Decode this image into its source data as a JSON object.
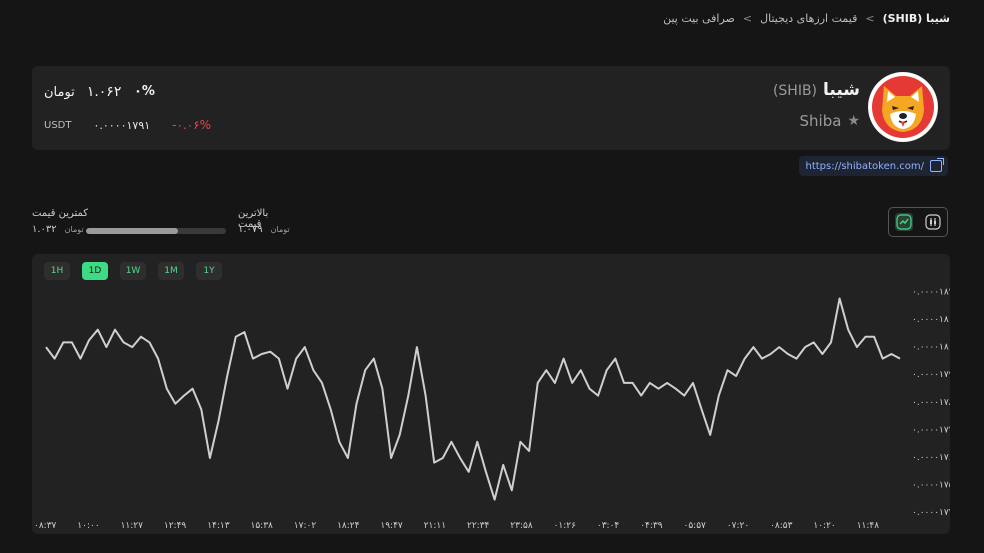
{
  "breadcrumb": {
    "items": [
      "صرافی بیت پین",
      "قیمت ارزهای دیجیتال",
      "شیبا (SHIB)"
    ],
    "separator": ">"
  },
  "coin": {
    "name_fa": "شیبا",
    "symbol": "(SHIB)",
    "name_en": "Shiba",
    "logo": "shiba-inu-logo-icon",
    "favorite_icon": "star-icon"
  },
  "price": {
    "toman_value": "۱.۰۶۲",
    "toman_unit": "تومان",
    "change": "۰%",
    "usdt_label": "USDT",
    "usdt_value": "۰.۰۰۰۰۱۷۹۱",
    "usdt_change": "-۰.۰۶%"
  },
  "website": {
    "url": "https://shibatoken.com/",
    "icon": "external-link-icon"
  },
  "range": {
    "low_label": "کمترین قیمت",
    "high_label": "بالاترین قیمت",
    "low_value": "۱.۰۳۲",
    "high_value": "۱.۰۷۹",
    "unit": "تومان",
    "position": 0.66
  },
  "view_toggle": {
    "line_icon": "line-chart-icon",
    "candle_icon": "candlestick-icon"
  },
  "timeframes": [
    {
      "label": "1H",
      "active": false
    },
    {
      "label": "1D",
      "active": true
    },
    {
      "label": "1W",
      "active": false
    },
    {
      "label": "1M",
      "active": false
    },
    {
      "label": "1Y",
      "active": false
    }
  ],
  "colors": {
    "accent": "#3ddc84",
    "negative": "#e5484d",
    "line": "#cfcfcf",
    "link": "#8fb2ff"
  },
  "chart_data": {
    "type": "line",
    "title": "",
    "xlabel": "",
    "ylabel": "",
    "ylim": [
      1.74e-05,
      1.822e-05
    ],
    "yticks": [
      "۰.۰۰۰۰۱۸۲",
      "۰.۰۰۰۰۱۸۱",
      "۰.۰۰۰۰۱۸",
      "۰.۰۰۰۰۱۷۹",
      "۰.۰۰۰۰۱۷۸",
      "۰.۰۰۰۰۱۷۷",
      "۰.۰۰۰۰۱۷۶",
      "۰.۰۰۰۰۱۷۵",
      "۰.۰۰۰۰۱۷۴"
    ],
    "ytick_values": [
      1.82e-05,
      1.81e-05,
      1.8e-05,
      1.79e-05,
      1.78e-05,
      1.77e-05,
      1.76e-05,
      1.75e-05,
      1.74e-05
    ],
    "xticks": [
      "۰۸:۳۷",
      "۱۰:۰۰",
      "۱۱:۲۷",
      "۱۲:۴۹",
      "۱۴:۱۳",
      "۱۵:۳۸",
      "۱۷:۰۲",
      "۱۸:۲۴",
      "۱۹:۴۷",
      "۲۱:۱۱",
      "۲۲:۳۴",
      "۲۳:۵۸",
      "۰۱:۲۶",
      "۰۳:۰۴",
      "۰۴:۳۹",
      "۰۵:۵۷",
      "۰۷:۲۰",
      "۰۸:۵۳",
      "۱۰:۲۰",
      "۱۱:۴۸"
    ],
    "series": [
      {
        "values": [
          1.79984e-05,
          1.79565e-05,
          1.80152e-05,
          1.80152e-05,
          1.79565e-05,
          1.80236e-05,
          1.80613e-05,
          1.79984e-05,
          1.80613e-05,
          1.80152e-05,
          1.79984e-05,
          1.80362e-05,
          1.80152e-05,
          1.79565e-05,
          1.78475e-05,
          1.7793e-05,
          1.78223e-05,
          1.78475e-05,
          1.77721e-05,
          1.7596e-05,
          1.77301e-05,
          1.78935e-05,
          1.80362e-05,
          1.80529e-05,
          1.79565e-05,
          1.79733e-05,
          1.79817e-05,
          1.79565e-05,
          1.78475e-05,
          1.79565e-05,
          1.79984e-05,
          1.79146e-05,
          1.78684e-05,
          1.77721e-05,
          1.76547e-05,
          1.7596e-05,
          1.7793e-05,
          1.79146e-05,
          1.79565e-05,
          1.78475e-05,
          1.7596e-05,
          1.76798e-05,
          1.78223e-05,
          1.79984e-05,
          1.78223e-05,
          1.75793e-05,
          1.7596e-05,
          1.76547e-05,
          1.7596e-05,
          1.75457e-05,
          1.76547e-05,
          1.75457e-05,
          1.74451e-05,
          1.75709e-05,
          1.74786e-05,
          1.76547e-05,
          1.76212e-05,
          1.78684e-05,
          1.79146e-05,
          1.78684e-05,
          1.79565e-05,
          1.78684e-05,
          1.79146e-05,
          1.78475e-05,
          1.78223e-05,
          1.79146e-05,
          1.79565e-05,
          1.78684e-05,
          1.78684e-05,
          1.78223e-05,
          1.78684e-05,
          1.78475e-05,
          1.78684e-05,
          1.78475e-05,
          1.78223e-05,
          1.78684e-05,
          1.77721e-05,
          1.76798e-05,
          1.78223e-05,
          1.79146e-05,
          1.78935e-05,
          1.79565e-05,
          1.79984e-05,
          1.79565e-05,
          1.79733e-05,
          1.79984e-05,
          1.79733e-05,
          1.79565e-05,
          1.79984e-05,
          1.80152e-05,
          1.79733e-05,
          1.80152e-05,
          1.81745e-05,
          1.80613e-05,
          1.79984e-05,
          1.80362e-05,
          1.80362e-05,
          1.79565e-05,
          1.79733e-05,
          1.79565e-05
        ]
      }
    ]
  }
}
